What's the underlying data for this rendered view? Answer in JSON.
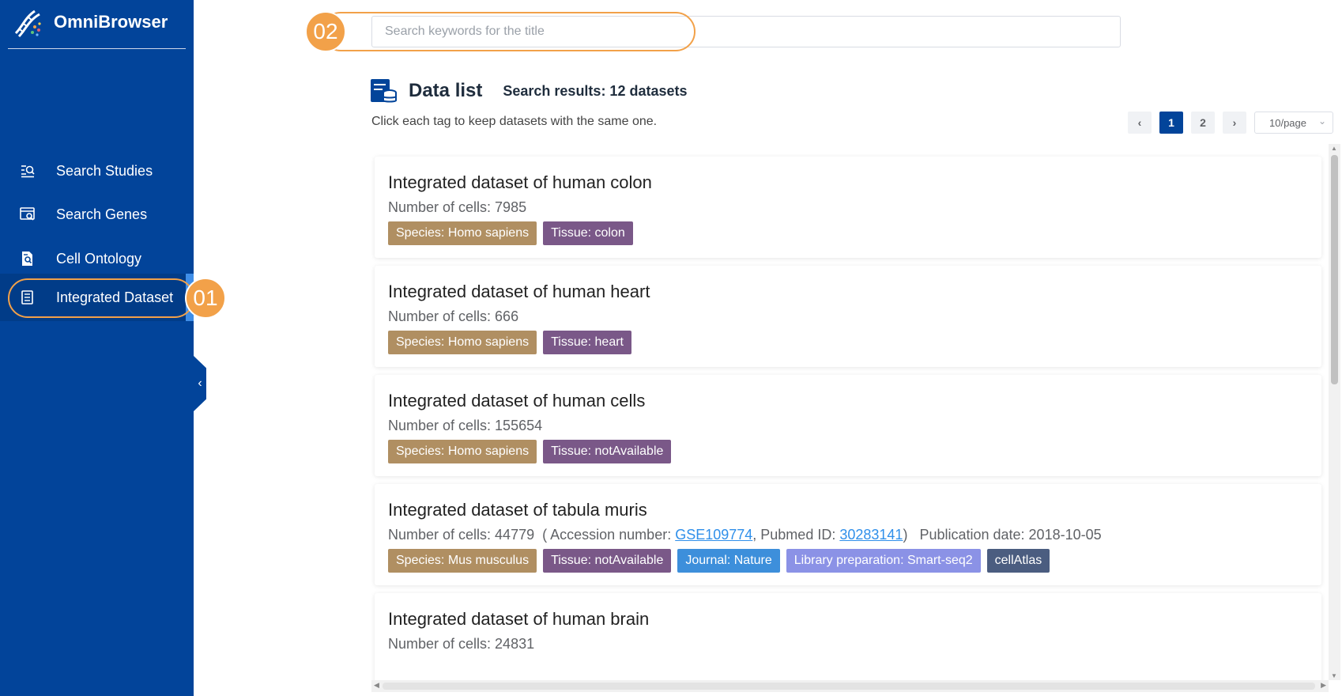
{
  "app": {
    "name": "OmniBrowser"
  },
  "sidebar": {
    "items": [
      {
        "label": "Search Studies",
        "icon": "search-list-icon"
      },
      {
        "label": "Search Genes",
        "icon": "search-window-icon"
      },
      {
        "label": "Cell Ontology",
        "icon": "document-search-icon"
      },
      {
        "label": "Integrated Dataset",
        "icon": "list-document-icon",
        "active": true
      }
    ],
    "collapse_label": "‹"
  },
  "annotations": {
    "step1": "01",
    "step2": "02"
  },
  "search": {
    "placeholder": "Search keywords for the title",
    "value": ""
  },
  "header": {
    "title": "Data list",
    "result_text": "Search results: 12 datasets",
    "hint": "Click each tag to keep datasets with the same one."
  },
  "pagination": {
    "prev": "‹",
    "pages": [
      "1",
      "2"
    ],
    "current": "1",
    "next": "›",
    "page_size": "10/page",
    "chevron": "⌄"
  },
  "colors": {
    "sidebar": "#02449a",
    "accent_orange": "#f2a149",
    "tag_species": "#b08f62",
    "tag_tissue": "#7a5888",
    "tag_journal": "#3d8fdb",
    "tag_library": "#8b92e6",
    "tag_cellatlas": "#4b5d80"
  },
  "datasets": [
    {
      "title": "Integrated dataset of human colon",
      "cells_text": "Number of cells: 7985",
      "tags": [
        {
          "label": "Species: Homo sapiens",
          "kind": "species"
        },
        {
          "label": "Tissue: colon",
          "kind": "tissue"
        }
      ]
    },
    {
      "title": "Integrated dataset of human heart",
      "cells_text": "Number of cells: 666",
      "tags": [
        {
          "label": "Species: Homo sapiens",
          "kind": "species"
        },
        {
          "label": "Tissue: heart",
          "kind": "tissue"
        }
      ]
    },
    {
      "title": "Integrated dataset of human cells",
      "cells_text": "Number of cells: 155654",
      "tags": [
        {
          "label": "Species: Homo sapiens",
          "kind": "species"
        },
        {
          "label": "Tissue: notAvailable",
          "kind": "tissue"
        }
      ]
    },
    {
      "title": "Integrated dataset of tabula muris",
      "cells_text": "Number of cells: 44779",
      "accession_prefix": "( Accession number: ",
      "accession": "GSE109774",
      "pubmed_prefix": ", Pubmed ID: ",
      "pubmed": "30283141",
      "pubmed_suffix": ")",
      "publication": "Publication date: 2018-10-05",
      "tags": [
        {
          "label": "Species: Mus musculus",
          "kind": "species"
        },
        {
          "label": "Tissue: notAvailable",
          "kind": "tissue"
        },
        {
          "label": "Journal: Nature",
          "kind": "journal"
        },
        {
          "label": "Library preparation: Smart-seq2",
          "kind": "library"
        },
        {
          "label": "cellAtlas",
          "kind": "cellatlas"
        }
      ]
    },
    {
      "title": "Integrated dataset of human brain",
      "cells_text": "Number of cells: 24831",
      "tags": []
    }
  ]
}
